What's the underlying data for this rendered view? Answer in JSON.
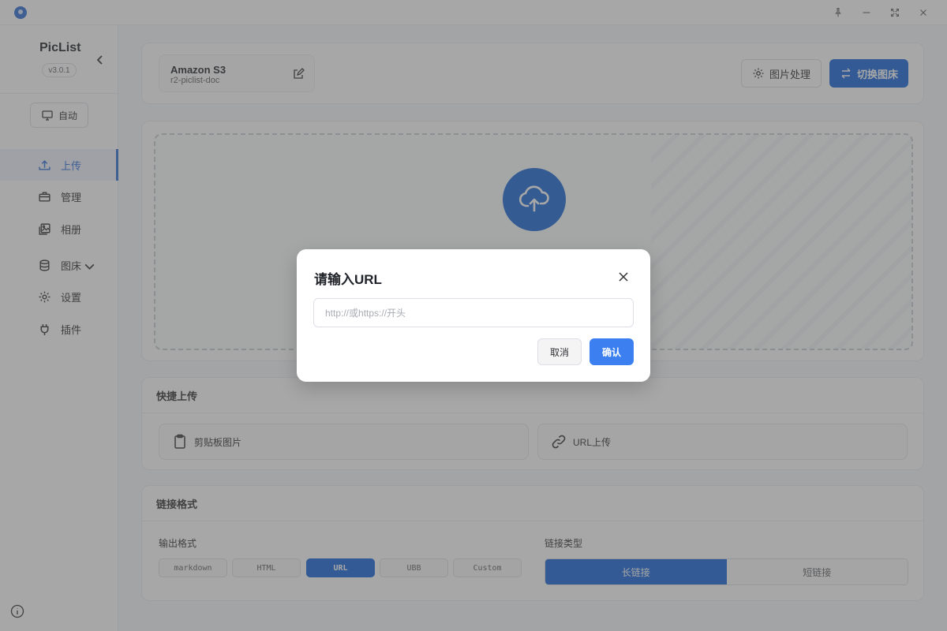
{
  "window": {
    "icons": [
      "app-icon",
      "pin-icon",
      "minimize-icon",
      "maximize-icon",
      "close-icon"
    ]
  },
  "sidebar": {
    "brand": "PicList",
    "version": "v3.0.1",
    "theme_label": "自动",
    "items": [
      {
        "label": "上传",
        "icon": "upload-icon",
        "active": true
      },
      {
        "label": "管理",
        "icon": "briefcase-icon"
      },
      {
        "label": "相册",
        "icon": "gallery-icon"
      },
      {
        "label": "图床",
        "icon": "database-icon",
        "has_submenu": true
      },
      {
        "label": "设置",
        "icon": "gear-icon"
      },
      {
        "label": "插件",
        "icon": "plug-icon"
      }
    ]
  },
  "header": {
    "picbed_name": "Amazon S3",
    "picbed_config": "r2-piclist-doc",
    "image_process_label": "图片处理",
    "switch_picbed_label": "切换图床"
  },
  "quick_upload": {
    "title": "快捷上传",
    "clipboard_label": "剪贴板图片",
    "url_label": "URL上传"
  },
  "link_format": {
    "title": "链接格式",
    "output_label": "输出格式",
    "formats": [
      "markdown",
      "HTML",
      "URL",
      "UBB",
      "Custom"
    ],
    "selected_format": "URL",
    "type_label": "链接类型",
    "types": [
      "长链接",
      "短链接"
    ],
    "selected_type": "长链接"
  },
  "dialog": {
    "title": "请输入URL",
    "input_value": "",
    "input_placeholder": "http://或https://开头",
    "cancel_label": "取消",
    "confirm_label": "确认"
  },
  "colors": {
    "primary": "#1764d8",
    "confirm": "#3b7ff0",
    "overlay": "rgba(80,80,80,0.5)"
  }
}
